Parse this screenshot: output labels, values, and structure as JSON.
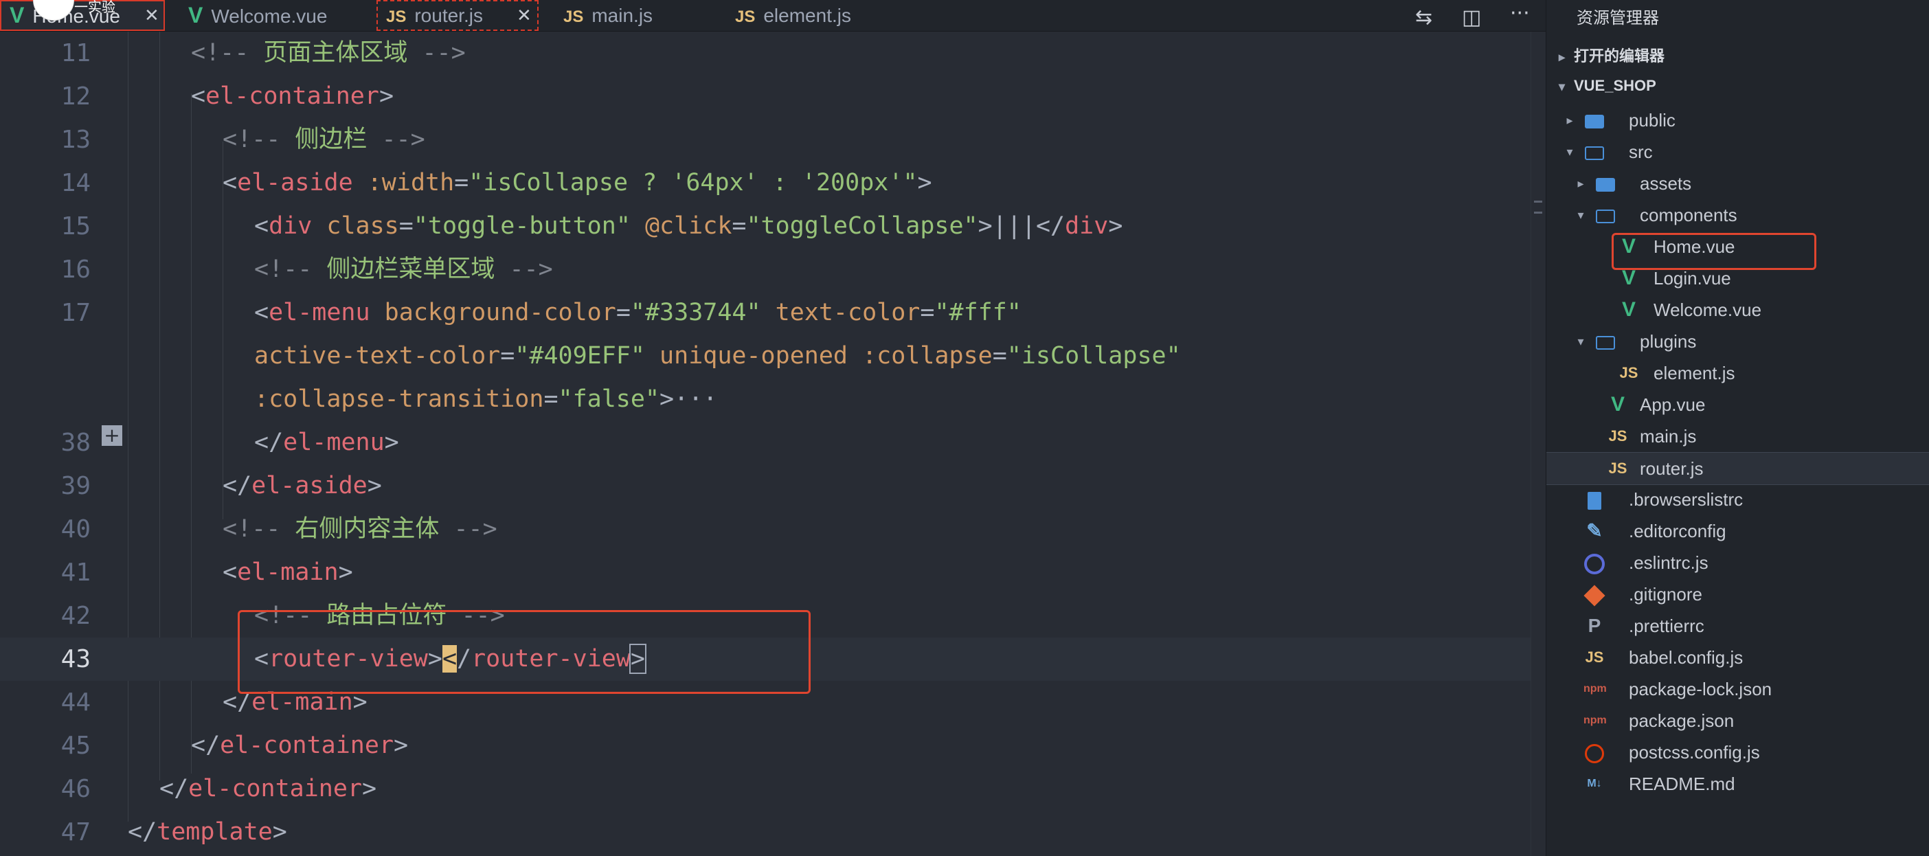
{
  "avatar": {
    "label": "一实验"
  },
  "tabs": [
    {
      "label": "Home.vue",
      "icon": "vue-icon",
      "close": "✕"
    },
    {
      "label": "Welcome.vue",
      "icon": "vue-icon"
    },
    {
      "label": "router.js",
      "icon": "js-icon",
      "close": "✕"
    },
    {
      "label": "main.js",
      "icon": "js-icon"
    },
    {
      "label": "element.js",
      "icon": "js-icon"
    }
  ],
  "toolbar": {
    "compare": "compare-icon",
    "split": "split-editor-icon",
    "more": "···"
  },
  "editor": {
    "fold_symbol": "+",
    "lines": [
      {
        "num": "11"
      },
      {
        "num": "12"
      },
      {
        "num": "13"
      },
      {
        "num": "14"
      },
      {
        "num": "15"
      },
      {
        "num": "16"
      },
      {
        "num": "17"
      },
      {
        "num": ""
      },
      {
        "num": ""
      },
      {
        "num": "38"
      },
      {
        "num": "39"
      },
      {
        "num": "40"
      },
      {
        "num": "41"
      },
      {
        "num": "42"
      },
      {
        "num": "43"
      },
      {
        "num": "44"
      },
      {
        "num": "45"
      },
      {
        "num": "46"
      },
      {
        "num": "47"
      }
    ],
    "code": {
      "l11_comment": "页面主体区域",
      "l13_comment": "侧边栏",
      "l16_comment": "侧边栏菜单区域",
      "l40_comment": "右侧内容主体",
      "l42_comment": "路由占位符",
      "el_container": "el-container",
      "el_aside": "el-aside",
      "width_attr": ":width",
      "width_val": "\"isCollapse ? '64px' : '200px'\"",
      "div": "div",
      "class_attr": "class",
      "class_val": "\"toggle-button\"",
      "click_attr": "@click",
      "click_val": "\"toggleCollapse\"",
      "pipes": "|||",
      "el_menu": "el-menu",
      "bg_attr": "background-color",
      "bg_val": "\"#333744\"",
      "tc_attr": "text-color",
      "tc_val": "\"#fff\"",
      "atc_attr": "active-text-color",
      "atc_val": "\"#409EFF\"",
      "uo_attr": "unique-opened",
      "col_attr": ":collapse",
      "col_val": "\"isCollapse\"",
      "ct_attr": ":collapse-transition",
      "ct_val": "\"false\"",
      "ellipsis": "···",
      "el_main": "el-main",
      "router_view": "router-view",
      "template": "template"
    }
  },
  "explorer": {
    "title": "资源管理器",
    "open_editors": "打开的编辑器",
    "project": "VUE_SHOP",
    "items": [
      {
        "label": "public",
        "type": "folder"
      },
      {
        "label": "src",
        "type": "folder-open"
      },
      {
        "label": "assets",
        "type": "folder"
      },
      {
        "label": "components",
        "type": "folder-open"
      },
      {
        "label": "Home.vue",
        "type": "vue"
      },
      {
        "label": "Login.vue",
        "type": "vue"
      },
      {
        "label": "Welcome.vue",
        "type": "vue"
      },
      {
        "label": "plugins",
        "type": "folder-open"
      },
      {
        "label": "element.js",
        "type": "js"
      },
      {
        "label": "App.vue",
        "type": "vue"
      },
      {
        "label": "main.js",
        "type": "js"
      },
      {
        "label": "router.js",
        "type": "js"
      },
      {
        "label": ".browserslistrc",
        "type": "file"
      },
      {
        "label": ".editorconfig",
        "type": "editorconfig"
      },
      {
        "label": ".eslintrc.js",
        "type": "eslint"
      },
      {
        "label": ".gitignore",
        "type": "git"
      },
      {
        "label": ".prettierrc",
        "type": "prettier"
      },
      {
        "label": "babel.config.js",
        "type": "js"
      },
      {
        "label": "package-lock.json",
        "type": "npm"
      },
      {
        "label": "package.json",
        "type": "npm"
      },
      {
        "label": "postcss.config.js",
        "type": "postcss"
      },
      {
        "label": "README.md",
        "type": "md"
      }
    ],
    "js_badge": "JS",
    "npm_badge": "npm",
    "md_badge": "M↓"
  },
  "colors": {
    "editor_bg": "#282c34",
    "highlight_box": "#e0452f",
    "vue_green": "#41b883",
    "js_yellow": "#e5c07b"
  }
}
